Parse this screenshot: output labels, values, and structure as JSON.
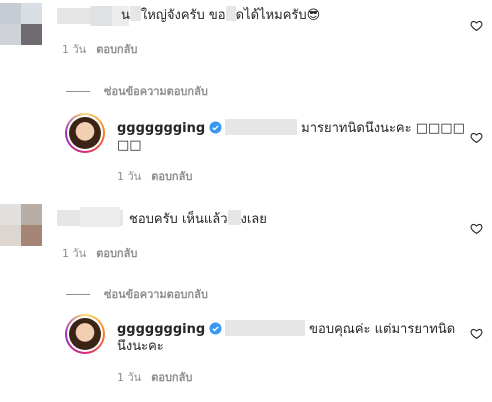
{
  "comments": [
    {
      "text_part1": "น",
      "text_part2": "ใหญ่จังครับ ขอ",
      "text_part3": "ดได้ไหมครับ",
      "emoji": "😎",
      "time": "1 วัน",
      "reply_label": "ตอบกลับ",
      "hide_replies_label": "ซ่อนข้อความตอบกลับ",
      "reply": {
        "username": "ggggggging",
        "text_line1": "มารยาทนิดนึงนะคะ □□□□",
        "text_line2": "□□",
        "time": "1 วัน",
        "reply_label": "ตอบกลับ"
      }
    },
    {
      "text_part1": "ชอบครับ เห็นแล้ว",
      "text_part2": "งเลย",
      "time": "1 วัน",
      "reply_label": "ตอบกลับ",
      "hide_replies_label": "ซ่อนข้อความตอบกลับ",
      "reply": {
        "username": "ggggggging",
        "text_line1": "ขอบคุณค่ะ แต่มารยาทนิด",
        "text_line2": "นึงนะคะ",
        "time": "1 วัน",
        "reply_label": "ตอบกลับ"
      }
    }
  ],
  "colors": {
    "muted": "#8e8e8e",
    "text": "#262626",
    "verified": "#3897f0"
  }
}
